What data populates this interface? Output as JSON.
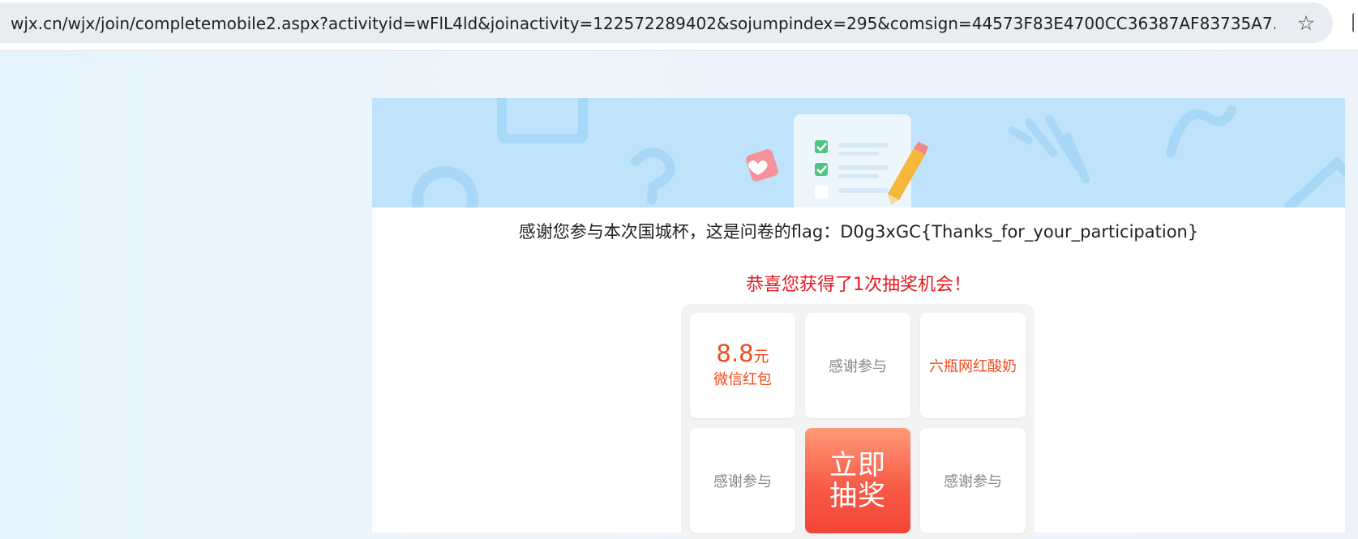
{
  "browser": {
    "url": "wjx.cn/wjx/join/completemobile2.aspx?activityid=wFlL4ld&joinactivity=122572289402&sojumpindex=295&comsign=44573F83E4700CC36387AF83735A7..."
  },
  "page": {
    "thanks_message": "感谢您参与本次国城杯，这是问卷的flag：D0g3xGC{Thanks_for_your_participation}",
    "congrats_message": "恭喜您获得了1次抽奖机会！"
  },
  "lottery": {
    "prize1_amount": "8.8",
    "prize1_unit": "元",
    "prize1_desc": "微信红包",
    "prize2": "感谢参与",
    "prize3": "六瓶网红酸奶",
    "prize4": "感谢参与",
    "draw_button": "立即抽奖",
    "prize6": "感谢参与"
  },
  "colors": {
    "banner_bg": "#bee3fb",
    "congrats_red": "#e7171f",
    "prize_orange": "#f04b1c",
    "draw_button": "#f85c48"
  },
  "icons": {
    "star": "bookmark-star-icon",
    "banner": "survey-clipboard-illustration"
  }
}
